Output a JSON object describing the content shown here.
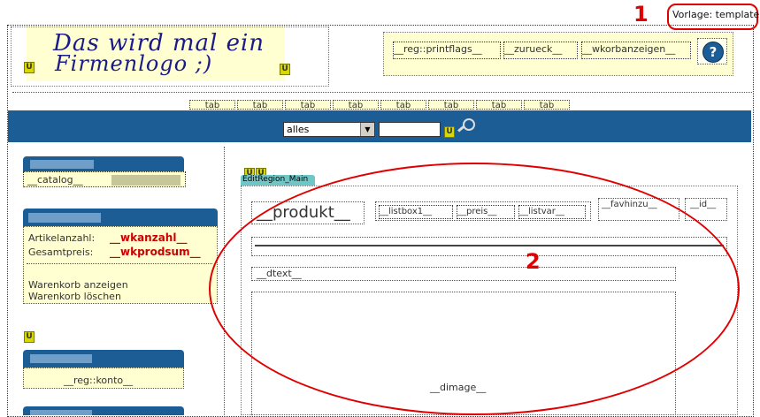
{
  "header": {
    "logo_text_line1": "Das wird mal ein",
    "logo_text_line2": "Firmenlogo ;)",
    "links": [
      "__reg::printflags__",
      "__zurueck__",
      "__wkorbanzeigen__"
    ],
    "help_icon": "question-icon"
  },
  "template_badge": "Vorlage: template",
  "annotations": {
    "one": "1",
    "two": "2"
  },
  "nav": {
    "tabs": [
      "tab",
      "tab",
      "tab",
      "tab",
      "tab",
      "tab",
      "tab",
      "tab"
    ],
    "select_value": "alles",
    "search_placeholder": "",
    "search_icon": "magnifier-icon"
  },
  "sidebar": {
    "catalog_label": "__catalog__",
    "cart": {
      "count_label": "Artikelanzahl:",
      "count_value": "__wkanzahl__",
      "sum_label": "Gesamtpreis:",
      "sum_value": "__wkprodsum__",
      "show_link": "Warenkorb anzeigen",
      "clear_link": "Warenkorb löschen"
    },
    "account_label": "__reg::konto__"
  },
  "main": {
    "region_label": "EditRegion_Main",
    "product": "__produkt__",
    "listbox": "__listbox1__",
    "price": "__preis__",
    "listvar": "__listvar__",
    "favhinzu": "__favhinzu__",
    "id": "__id__",
    "dtext": "__dtext__",
    "dimage": "__dimage__"
  },
  "colors": {
    "navy": "#1c5d96",
    "field_bg": "#ffffd2",
    "annotation_red": "#e00000",
    "region_tab": "#6fc6c6"
  }
}
